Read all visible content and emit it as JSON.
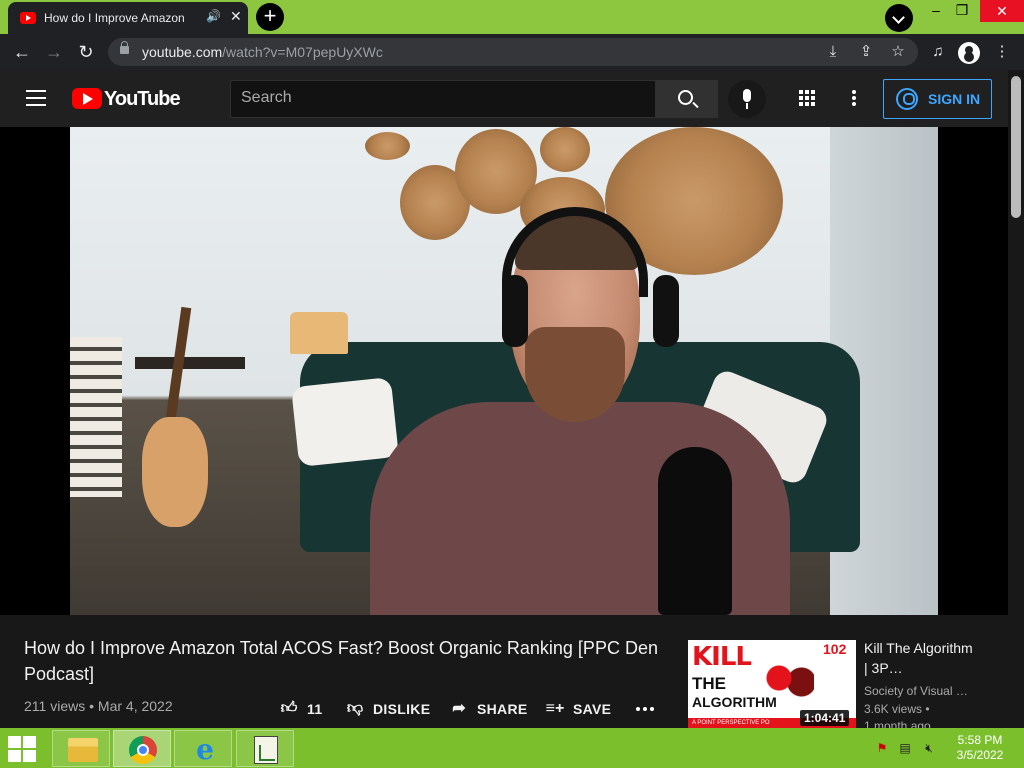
{
  "browser": {
    "tab_title": "How do I Improve Amazon Total ACOS Fast? Boost Organic Ranking [PPC Den Podcast] - YouTube",
    "tab_title_short": "How do I Improve Amazon T",
    "url_domain": "youtube.com",
    "url_path": "/watch?v=M07pepUyXWc",
    "new_tab_label": "+",
    "window_controls": {
      "minimize": "–",
      "restore": "❐",
      "close": "✕"
    }
  },
  "youtube": {
    "logo_text": "YouTube",
    "search": {
      "placeholder": "Search"
    },
    "sign_in_label": "SIGN IN"
  },
  "video": {
    "title": "How do I Improve Amazon Total ACOS Fast? Boost Organic Ranking [PPC Den Podcast]",
    "views": "211 views",
    "separator": "•",
    "date": "Mar 4, 2022",
    "actions": {
      "like_count": "11",
      "dislike_label": "DISLIKE",
      "share_label": "SHARE",
      "save_label": "SAVE"
    }
  },
  "recommendation": {
    "thumb_kill": "KILL",
    "thumb_the": "THE",
    "thumb_algorithm": "ALGORITHM",
    "thumb_number": "102",
    "thumb_strip": "A POINT PERSPECTIVE PO",
    "duration": "1:04:41",
    "title": "Kill The Algorithm | 3P…",
    "channel": "Society of Visual …",
    "views": "3.6K views •",
    "age": "1 month ago"
  },
  "taskbar": {
    "time": "5:58 PM",
    "date": "3/5/2022",
    "ie_glyph": "e"
  }
}
